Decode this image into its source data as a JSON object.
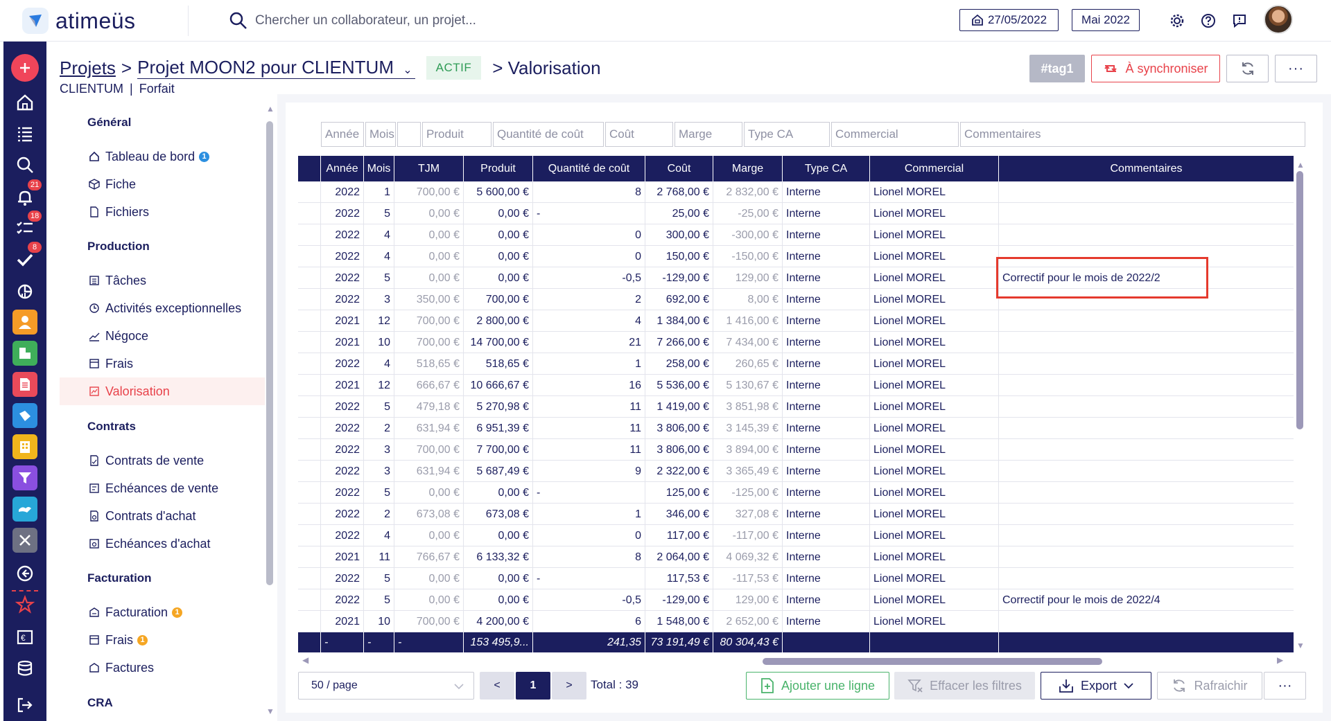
{
  "app": {
    "brand": "atimeüs",
    "search_placeholder": "Chercher un collaborateur, un projet...",
    "date": "27/05/2022",
    "month": "Mai 2022"
  },
  "rail": {
    "badges": {
      "notifications": "21",
      "tasks": "18",
      "validations": "8"
    }
  },
  "header": {
    "breadcrumb_root": "Projets",
    "separator": ">",
    "project": "Projet MOON2 pour CLIENTUM",
    "status": "ACTIF",
    "page": "> Valorisation",
    "subtitle_client": "CLIENTUM",
    "subtitle_sep": "|",
    "subtitle_type": "Forfait",
    "tag": "#tag1",
    "sync_label": "À synchroniser",
    "more": "···"
  },
  "nav": {
    "general": "Général",
    "dashboard": "Tableau de bord",
    "dashboard_badge": "1",
    "fiche": "Fiche",
    "fichiers": "Fichiers",
    "production": "Production",
    "taches": "Tâches",
    "activites": "Activités exceptionnelles",
    "negoce": "Négoce",
    "frais": "Frais",
    "valorisation": "Valorisation",
    "contrats": "Contrats",
    "contrats_vente": "Contrats de vente",
    "echeances_vente": "Echéances de vente",
    "contrats_achat": "Contrats d'achat",
    "echeances_achat": "Echéances d'achat",
    "facturation_heading": "Facturation",
    "facturation": "Facturation",
    "facturation_badge": "1",
    "frais_fact": "Frais",
    "frais_fact_badge": "1",
    "factures": "Factures",
    "cra": "CRA"
  },
  "filters": {
    "annee": "Année",
    "mois": "Mois",
    "produit": "Produit",
    "quantite": "Quantité de coût",
    "cout": "Coût",
    "marge": "Marge",
    "type_ca": "Type CA",
    "commercial": "Commercial",
    "commentaires": "Commentaires"
  },
  "columns": {
    "annee": "Année",
    "mois": "Mois",
    "tjm": "TJM",
    "produit": "Produit",
    "quantite": "Quantité de coût",
    "cout": "Coût",
    "marge": "Marge",
    "type_ca": "Type CA",
    "commercial": "Commercial",
    "commentaires": "Commentaires"
  },
  "rows": [
    {
      "annee": "2022",
      "mois": "1",
      "tjm": "700,00 €",
      "produit": "5 600,00 €",
      "qte": "8",
      "cout": "2 768,00 €",
      "marge": "2 832,00 €",
      "type": "Interne",
      "commercial": "Lionel MOREL",
      "comment": ""
    },
    {
      "annee": "2022",
      "mois": "5",
      "tjm": "0,00 €",
      "produit": "0,00 €",
      "qte": "-",
      "cout": "25,00 €",
      "marge": "-25,00 €",
      "type": "Interne",
      "commercial": "Lionel MOREL",
      "comment": ""
    },
    {
      "annee": "2022",
      "mois": "4",
      "tjm": "0,00 €",
      "produit": "0,00 €",
      "qte": "0",
      "cout": "300,00 €",
      "marge": "-300,00 €",
      "type": "Interne",
      "commercial": "Lionel MOREL",
      "comment": ""
    },
    {
      "annee": "2022",
      "mois": "4",
      "tjm": "0,00 €",
      "produit": "0,00 €",
      "qte": "0",
      "cout": "150,00 €",
      "marge": "-150,00 €",
      "type": "Interne",
      "commercial": "Lionel MOREL",
      "comment": ""
    },
    {
      "annee": "2022",
      "mois": "5",
      "tjm": "0,00 €",
      "produit": "0,00 €",
      "qte": "-0,5",
      "cout": "-129,00 €",
      "marge": "129,00 €",
      "type": "Interne",
      "commercial": "Lionel MOREL",
      "comment": "Correctif pour le mois de 2022/2"
    },
    {
      "annee": "2022",
      "mois": "3",
      "tjm": "350,00 €",
      "produit": "700,00 €",
      "qte": "2",
      "cout": "692,00 €",
      "marge": "8,00 €",
      "type": "Interne",
      "commercial": "Lionel MOREL",
      "comment": ""
    },
    {
      "annee": "2021",
      "mois": "12",
      "tjm": "700,00 €",
      "produit": "2 800,00 €",
      "qte": "4",
      "cout": "1 384,00 €",
      "marge": "1 416,00 €",
      "type": "Interne",
      "commercial": "Lionel MOREL",
      "comment": ""
    },
    {
      "annee": "2021",
      "mois": "10",
      "tjm": "700,00 €",
      "produit": "14 700,00 €",
      "qte": "21",
      "cout": "7 266,00 €",
      "marge": "7 434,00 €",
      "type": "Interne",
      "commercial": "Lionel MOREL",
      "comment": ""
    },
    {
      "annee": "2022",
      "mois": "4",
      "tjm": "518,65 €",
      "produit": "518,65 €",
      "qte": "1",
      "cout": "258,00 €",
      "marge": "260,65 €",
      "type": "Interne",
      "commercial": "Lionel MOREL",
      "comment": ""
    },
    {
      "annee": "2021",
      "mois": "12",
      "tjm": "666,67 €",
      "produit": "10 666,67 €",
      "qte": "16",
      "cout": "5 536,00 €",
      "marge": "5 130,67 €",
      "type": "Interne",
      "commercial": "Lionel MOREL",
      "comment": ""
    },
    {
      "annee": "2022",
      "mois": "5",
      "tjm": "479,18 €",
      "produit": "5 270,98 €",
      "qte": "11",
      "cout": "1 419,00 €",
      "marge": "3 851,98 €",
      "type": "Interne",
      "commercial": "Lionel MOREL",
      "comment": ""
    },
    {
      "annee": "2022",
      "mois": "2",
      "tjm": "631,94 €",
      "produit": "6 951,39 €",
      "qte": "11",
      "cout": "3 806,00 €",
      "marge": "3 145,39 €",
      "type": "Interne",
      "commercial": "Lionel MOREL",
      "comment": ""
    },
    {
      "annee": "2022",
      "mois": "3",
      "tjm": "700,00 €",
      "produit": "7 700,00 €",
      "qte": "11",
      "cout": "3 806,00 €",
      "marge": "3 894,00 €",
      "type": "Interne",
      "commercial": "Lionel MOREL",
      "comment": ""
    },
    {
      "annee": "2022",
      "mois": "3",
      "tjm": "631,94 €",
      "produit": "5 687,49 €",
      "qte": "9",
      "cout": "2 322,00 €",
      "marge": "3 365,49 €",
      "type": "Interne",
      "commercial": "Lionel MOREL",
      "comment": ""
    },
    {
      "annee": "2022",
      "mois": "5",
      "tjm": "0,00 €",
      "produit": "0,00 €",
      "qte": "-",
      "cout": "125,00 €",
      "marge": "-125,00 €",
      "type": "Interne",
      "commercial": "Lionel MOREL",
      "comment": ""
    },
    {
      "annee": "2022",
      "mois": "2",
      "tjm": "673,08 €",
      "produit": "673,08 €",
      "qte": "1",
      "cout": "346,00 €",
      "marge": "327,08 €",
      "type": "Interne",
      "commercial": "Lionel MOREL",
      "comment": ""
    },
    {
      "annee": "2022",
      "mois": "4",
      "tjm": "0,00 €",
      "produit": "0,00 €",
      "qte": "0",
      "cout": "117,00 €",
      "marge": "-117,00 €",
      "type": "Interne",
      "commercial": "Lionel MOREL",
      "comment": ""
    },
    {
      "annee": "2021",
      "mois": "11",
      "tjm": "766,67 €",
      "produit": "6 133,32 €",
      "qte": "8",
      "cout": "2 064,00 €",
      "marge": "4 069,32 €",
      "type": "Interne",
      "commercial": "Lionel MOREL",
      "comment": ""
    },
    {
      "annee": "2022",
      "mois": "5",
      "tjm": "0,00 €",
      "produit": "0,00 €",
      "qte": "-",
      "cout": "117,53 €",
      "marge": "-117,53 €",
      "type": "Interne",
      "commercial": "Lionel MOREL",
      "comment": ""
    },
    {
      "annee": "2022",
      "mois": "5",
      "tjm": "0,00 €",
      "produit": "0,00 €",
      "qte": "-0,5",
      "cout": "-129,00 €",
      "marge": "129,00 €",
      "type": "Interne",
      "commercial": "Lionel MOREL",
      "comment": "Correctif pour le mois de 2022/4"
    },
    {
      "annee": "2021",
      "mois": "10",
      "tjm": "700,00 €",
      "produit": "4 200,00 €",
      "qte": "6",
      "cout": "1 548,00 €",
      "marge": "2 652,00 €",
      "type": "Interne",
      "commercial": "Lionel MOREL",
      "comment": ""
    }
  ],
  "totals": {
    "annee": "-",
    "mois": "-",
    "tjm": "-",
    "produit": "153 495,9...",
    "qte": "241,35",
    "cout": "73 191,49 €",
    "marge": "80 304,43 €"
  },
  "pager": {
    "page_size": "50 / page",
    "prev": "<",
    "current": "1",
    "next": ">",
    "total": "Total : 39"
  },
  "actions": {
    "add_row": "Ajouter une ligne",
    "clear_filters": "Effacer les filtres",
    "export": "Export",
    "refresh": "Rafraichir",
    "more": "···"
  }
}
